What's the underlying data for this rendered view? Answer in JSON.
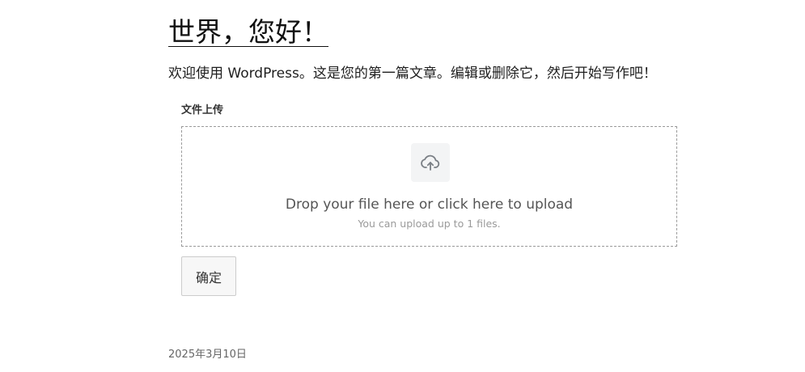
{
  "post": {
    "title": "世界，您好！",
    "intro": "欢迎使用 WordPress。这是您的第一篇文章。编辑或删除它，然后开始写作吧！",
    "date": "2025年3月10日"
  },
  "upload_form": {
    "label": "文件上传",
    "icon": "cloud-upload-icon",
    "drop_text": "Drop your file here or click here to upload",
    "hint": "You can upload up to 1 files.",
    "submit_label": "确定"
  }
}
